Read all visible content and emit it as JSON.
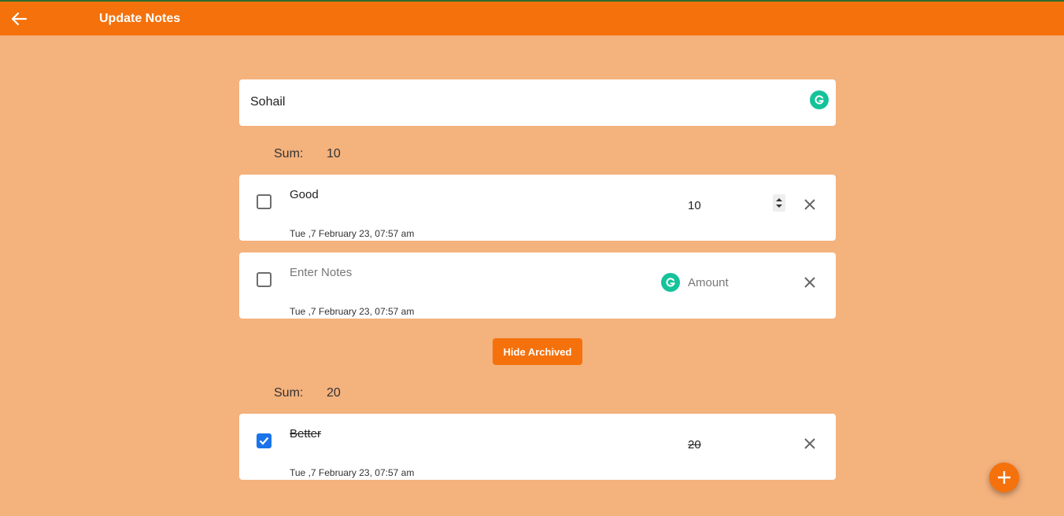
{
  "app": {
    "title": "Update Notes"
  },
  "note": {
    "title": "Sohail"
  },
  "active": {
    "sum_label": "Sum:",
    "sum_value": "10",
    "items": [
      {
        "text": "Good",
        "placeholder": "Enter Notes",
        "date": "Tue ,7 February 23, 07:57 am",
        "amount": "10",
        "amount_placeholder": "Amount",
        "checked": false
      },
      {
        "text": "",
        "placeholder": "Enter Notes",
        "date": "Tue ,7 February 23, 07:57 am",
        "amount": "",
        "amount_placeholder": "Amount",
        "checked": false
      }
    ]
  },
  "toggle": {
    "label": "Hide Archived"
  },
  "archived": {
    "sum_label": "Sum:",
    "sum_value": "20",
    "items": [
      {
        "text": "Better",
        "date": "Tue ,7 February 23, 07:57 am",
        "amount": "20",
        "checked": true
      }
    ]
  },
  "colors": {
    "header": "#f5710b",
    "background": "#f4b27d",
    "grammarly": "#15c39a",
    "checkbox": "#1a73e8"
  },
  "icons": {
    "back": "arrow-left-icon",
    "grammarly": "grammarly-icon",
    "close": "close-icon",
    "check": "check-icon",
    "fab": "plus-icon"
  }
}
